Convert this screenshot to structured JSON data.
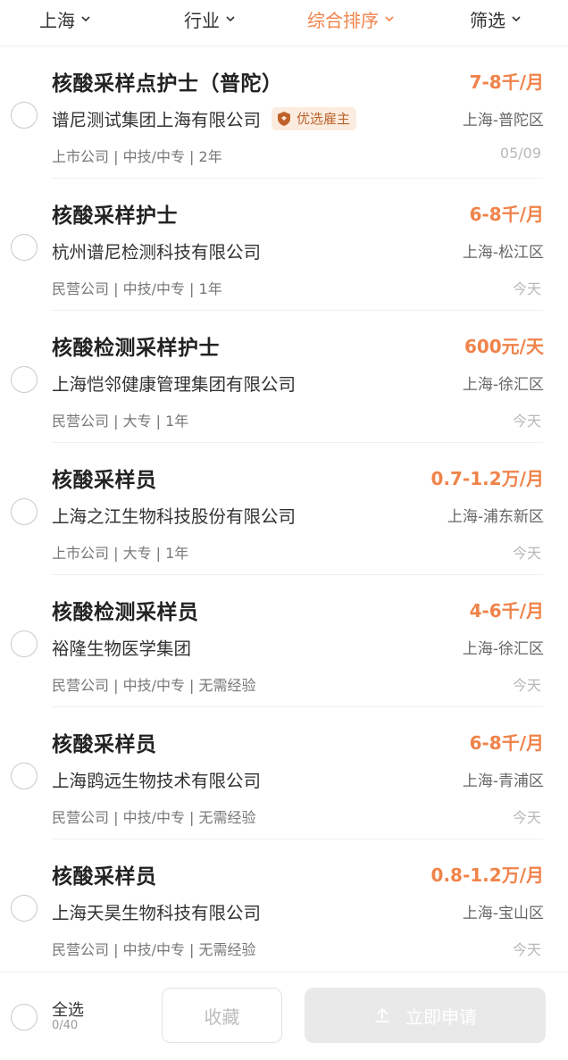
{
  "filters": [
    {
      "label": "上海",
      "active": false
    },
    {
      "label": "行业",
      "active": false
    },
    {
      "label": "综合排序",
      "active": true
    },
    {
      "label": "筛选",
      "active": false
    }
  ],
  "accent_color": "#f0834a",
  "jobs": [
    {
      "title": "核酸采样点护士（普陀）",
      "salary": "7-8千/月",
      "company": "谱尼测试集团上海有限公司",
      "badge": "优选雇主",
      "location": "上海-普陀区",
      "meta": "上市公司 | 中技/中专 | 2年",
      "date": "05/09"
    },
    {
      "title": "核酸采样护士",
      "salary": "6-8千/月",
      "company": "杭州谱尼检测科技有限公司",
      "badge": "",
      "location": "上海-松江区",
      "meta": "民营公司 | 中技/中专 | 1年",
      "date": "今天"
    },
    {
      "title": "核酸检测采样护士",
      "salary": "600元/天",
      "company": "上海恺邻健康管理集团有限公司",
      "badge": "",
      "location": "上海-徐汇区",
      "meta": "民营公司 | 大专 | 1年",
      "date": "今天"
    },
    {
      "title": "核酸采样员",
      "salary": "0.7-1.2万/月",
      "company": "上海之江生物科技股份有限公司",
      "badge": "",
      "location": "上海-浦东新区",
      "meta": "上市公司 | 大专 | 1年",
      "date": "今天"
    },
    {
      "title": "核酸检测采样员",
      "salary": "4-6千/月",
      "company": "裕隆生物医学集团",
      "badge": "",
      "location": "上海-徐汇区",
      "meta": "民营公司 | 中技/中专 | 无需经验",
      "date": "今天"
    },
    {
      "title": "核酸采样员",
      "salary": "6-8千/月",
      "company": "上海鹍远生物技术有限公司",
      "badge": "",
      "location": "上海-青浦区",
      "meta": "民营公司 | 中技/中专 | 无需经验",
      "date": "今天"
    },
    {
      "title": "核酸采样员",
      "salary": "0.8-1.2万/月",
      "company": "上海天昊生物科技有限公司",
      "badge": "",
      "location": "上海-宝山区",
      "meta": "民营公司 | 中技/中专 | 无需经验",
      "date": "今天"
    }
  ],
  "bottom": {
    "select_all": "全选",
    "count": "0/40",
    "favorite": "收藏",
    "apply": "立即申请"
  }
}
